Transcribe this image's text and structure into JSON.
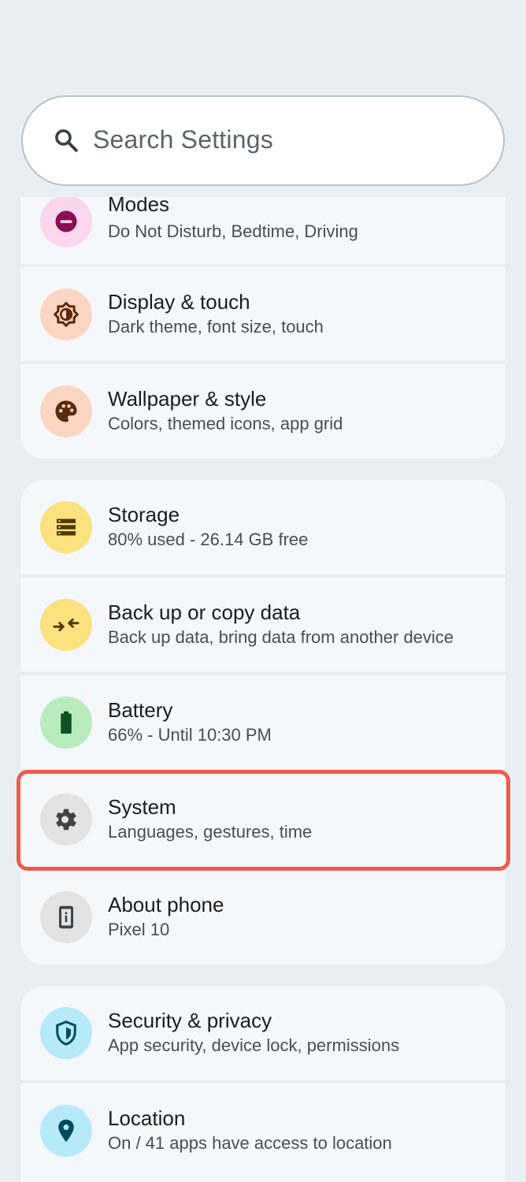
{
  "search": {
    "placeholder": "Search Settings"
  },
  "groups": [
    {
      "items": [
        {
          "title": "Modes",
          "subtitle": "Do Not Disturb, Bedtime, Driving",
          "icon": "do-not-disturb-icon",
          "color": "#fbd6ec"
        },
        {
          "title": "Display & touch",
          "subtitle": "Dark theme, font size, touch",
          "icon": "brightness-icon",
          "color": "#fcd6c2"
        },
        {
          "title": "Wallpaper & style",
          "subtitle": "Colors, themed icons, app grid",
          "icon": "palette-icon",
          "color": "#fcd6c2"
        }
      ]
    },
    {
      "items": [
        {
          "title": "Storage",
          "subtitle": "80% used - 26.14 GB free",
          "icon": "storage-icon",
          "color": "#fbe27f"
        },
        {
          "title": "Back up or copy data",
          "subtitle": "Back up data, bring data from another device",
          "icon": "backup-transfer-icon",
          "color": "#fbe27f"
        },
        {
          "title": "Battery",
          "subtitle": "66% - Until 10:30 PM",
          "icon": "battery-icon",
          "color": "#b8ecbf"
        },
        {
          "title": "System",
          "subtitle": "Languages, gestures, time",
          "icon": "gear-icon",
          "color": "#e3e3e3"
        },
        {
          "title": "About phone",
          "subtitle": "Pixel 10",
          "icon": "phone-info-icon",
          "color": "#e3e3e3"
        }
      ]
    },
    {
      "items": [
        {
          "title": "Security & privacy",
          "subtitle": "App security, device lock, permissions",
          "icon": "shield-icon",
          "color": "#b7eaf9"
        },
        {
          "title": "Location",
          "subtitle": "On / 41 apps have access to location",
          "icon": "location-pin-icon",
          "color": "#b7eaf9"
        }
      ]
    }
  ],
  "colors": {
    "background": "#e8eef2",
    "card": "#f5f8fb",
    "highlight": "#f05a4f"
  }
}
